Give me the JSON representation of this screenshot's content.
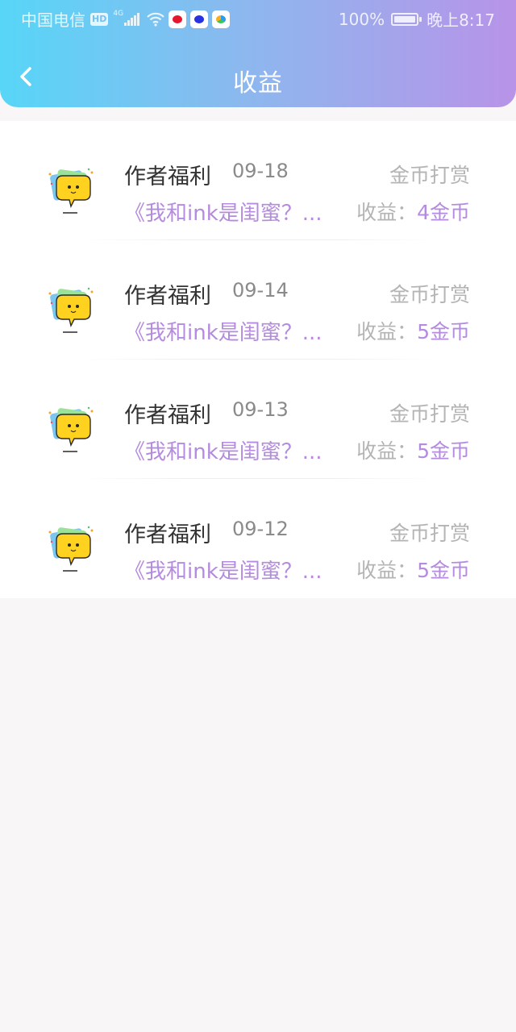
{
  "status_bar": {
    "carrier": "中国电信",
    "hd": "HD",
    "network": "4G",
    "battery": "100%",
    "time": "晚上8:17",
    "icons": [
      "wifi-icon",
      "weibo-icon",
      "baidu-icon",
      "browser-icon",
      "battery-icon"
    ]
  },
  "header": {
    "title": "收益",
    "back_icon": "chevron-left-icon",
    "gradient": [
      "#57d6f7",
      "#b893e8"
    ]
  },
  "colors": {
    "accent": "#b58be0",
    "muted": "#b4b4b4",
    "text": "#333333"
  },
  "earnings": [
    {
      "title": "作者福利",
      "date": "09-18",
      "type": "金币打赏",
      "book": "《我和ink是闺蜜？...",
      "earn_label": "收益：",
      "earn_value": "4金币"
    },
    {
      "title": "作者福利",
      "date": "09-14",
      "type": "金币打赏",
      "book": "《我和ink是闺蜜？...",
      "earn_label": "收益：",
      "earn_value": "5金币"
    },
    {
      "title": "作者福利",
      "date": "09-13",
      "type": "金币打赏",
      "book": "《我和ink是闺蜜？...",
      "earn_label": "收益：",
      "earn_value": "5金币"
    },
    {
      "title": "作者福利",
      "date": "09-12",
      "type": "金币打赏",
      "book": "《我和ink是闺蜜？...",
      "earn_label": "收益：",
      "earn_value": "5金币"
    }
  ]
}
